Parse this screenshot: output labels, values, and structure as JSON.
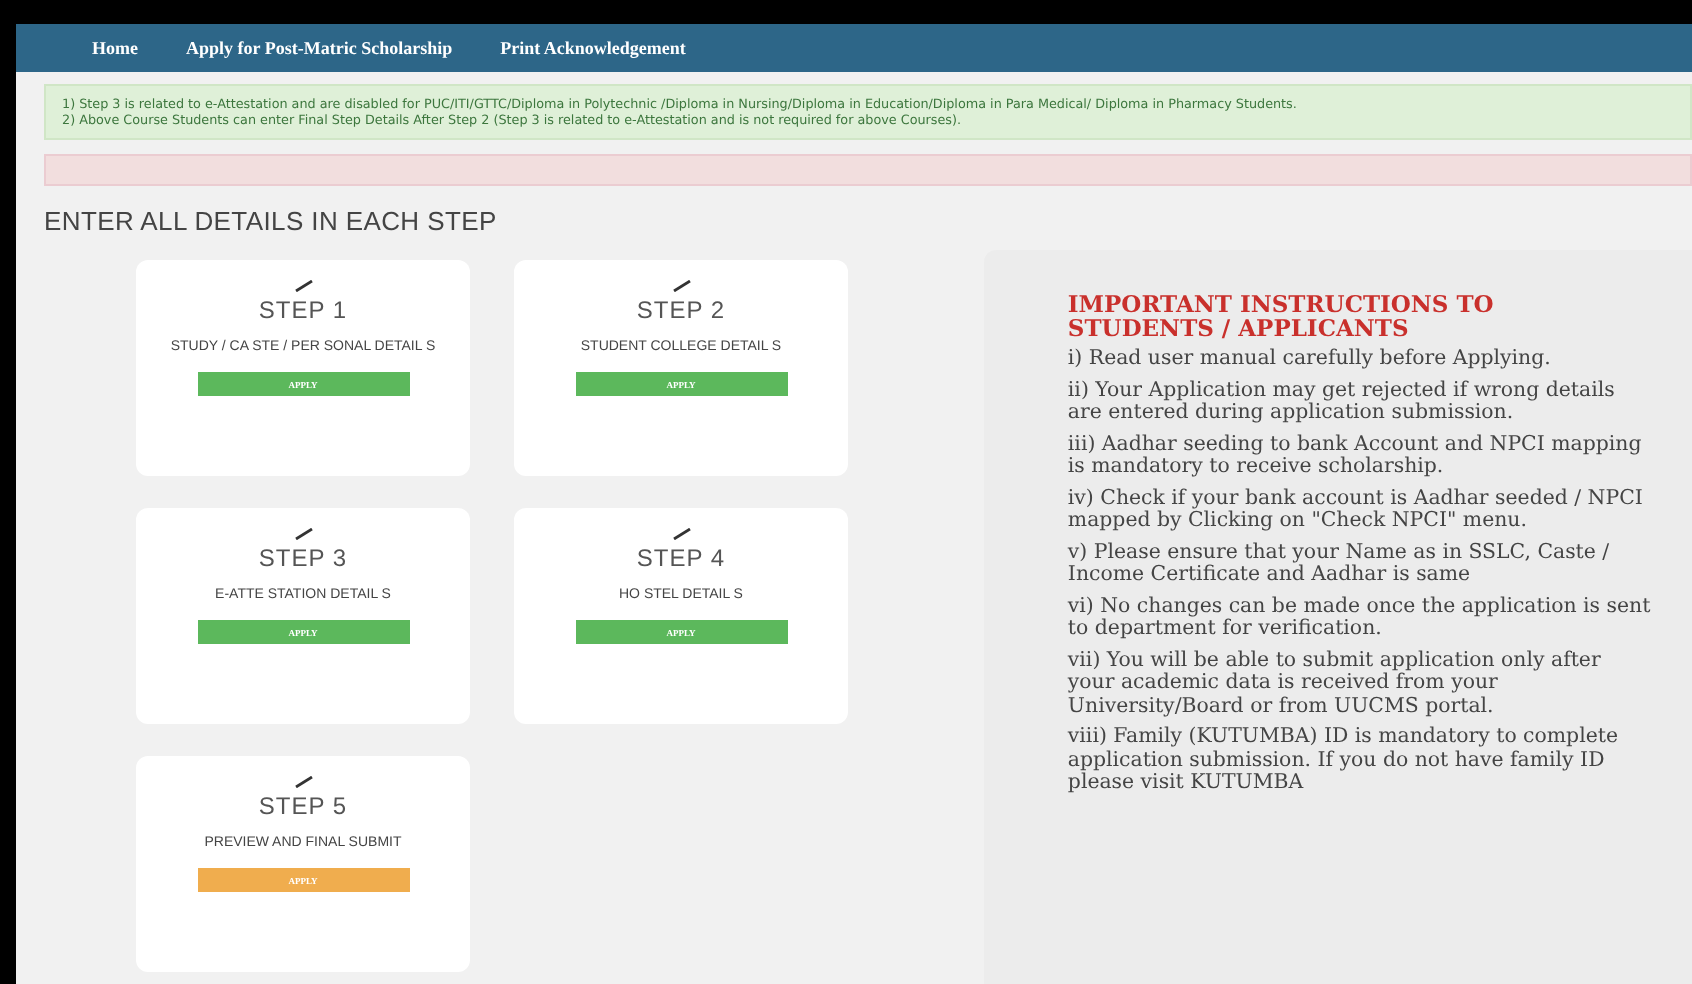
{
  "nav": {
    "items": [
      {
        "label": "Home"
      },
      {
        "label": "Apply for Post-Matric Scholarship"
      },
      {
        "label": "Print Acknowledgement"
      }
    ]
  },
  "notice": {
    "lines": [
      "1) Step 3 is related to e-Attestation and are disabled for PUC/ITI/GTTC/Diploma in Polytechnic /Diploma in Nursing/Diploma in Education/Diploma in Para Medical/ Diploma in Pharmacy Students.",
      "2) Above Course Students can enter Final Step Details After Step 2 (Step 3 is related to e-Attestation and is not required for above Courses)."
    ]
  },
  "heading": "ENTER ALL DETAILS IN EACH STEP",
  "steps": [
    {
      "title": "STEP 1",
      "description": "STUDY / CA STE / PER SONAL DETAIL S",
      "button": "APPLY",
      "color": "#5cb85c"
    },
    {
      "title": "STEP 2",
      "description": "STUDENT COLLEGE DETAIL S",
      "button": "APPLY",
      "color": "#5cb85c"
    },
    {
      "title": "STEP 3",
      "description": "E-ATTE STATION DETAIL S",
      "button": "APPLY",
      "color": "#5cb85c"
    },
    {
      "title": "STEP 4",
      "description": "HO STEL DETAIL S",
      "button": "APPLY",
      "color": "#5cb85c"
    },
    {
      "title": "STEP 5",
      "description": "PREVIEW AND FINAL SUBMIT",
      "button": "APPLY",
      "color": "#f0ad4e"
    }
  ],
  "instructions": {
    "title": "IMPORTANT INSTRUCTIONS TO STUDENTS / APPLICANTS",
    "items": [
      "i) Read user manual carefully before Applying.",
      "ii) Your Application may get rejected if wrong details are entered during application submission.",
      "iii) Aadhar seeding to bank Account and NPCI mapping is mandatory to receive scholarship.",
      "iv) Check if your bank account is Aadhar seeded / NPCI mapped by Clicking on \"Check NPCI\" menu.",
      "v) Please ensure that your Name as in SSLC, Caste / Income Certificate and Aadhar is same",
      "vi) No changes can be made once the application is sent to department for verification.",
      "vii) You will be able to submit application only after your academic data is received from your University/Board or from UUCMS portal.",
      "viii) Family (KUTUMBA) ID is mandatory to complete application submission. If you do not have family ID please visit KUTUMBA"
    ]
  }
}
